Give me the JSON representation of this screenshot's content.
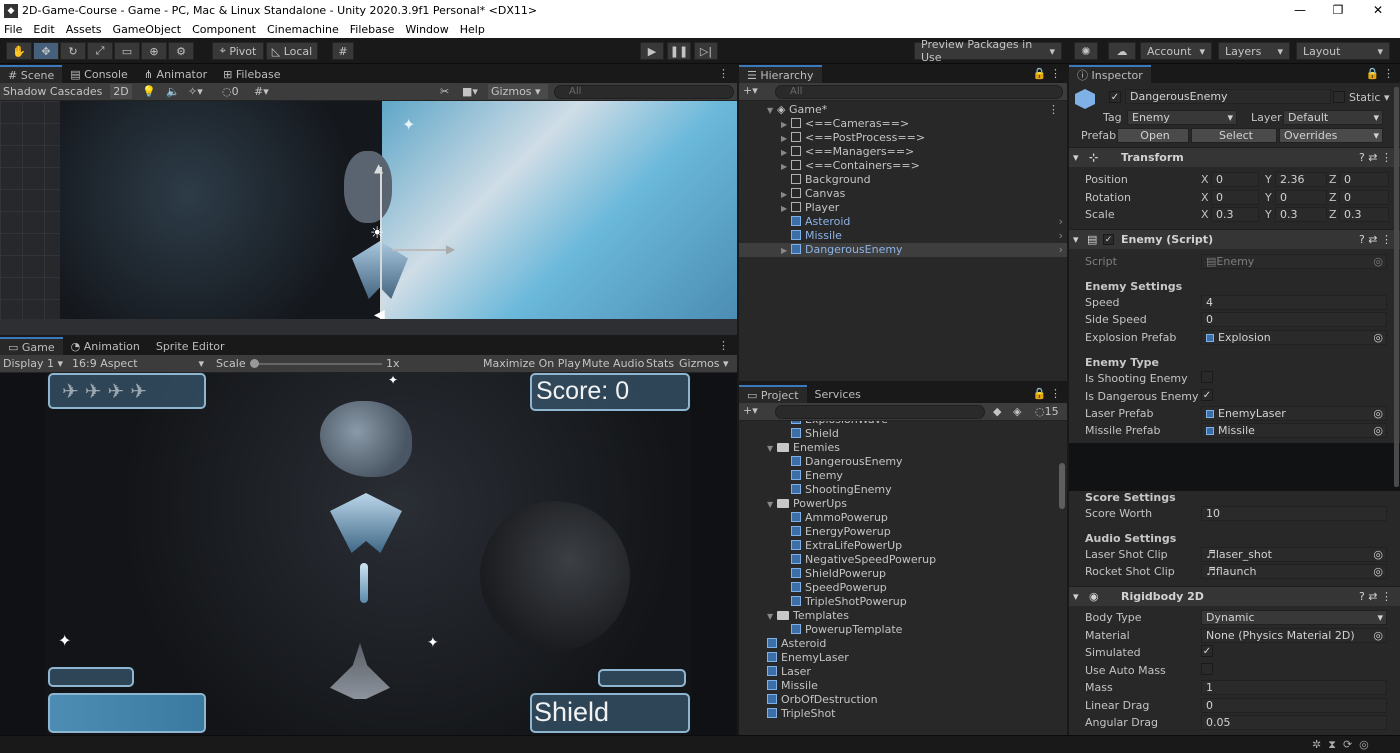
{
  "window": {
    "title": "2D-Game-Course - Game - PC, Mac & Linux Standalone - Unity 2020.3.9f1 Personal* <DX11>"
  },
  "menu": [
    "File",
    "Edit",
    "Assets",
    "GameObject",
    "Component",
    "Cinemachine",
    "Filebase",
    "Window",
    "Help"
  ],
  "toolbar": {
    "pivot": "Pivot",
    "local": "Local",
    "preview_packages": "Preview Packages in Use",
    "account": "Account",
    "layers": "Layers",
    "layout": "Layout"
  },
  "scene": {
    "tabs": [
      "Scene",
      "Console",
      "Animator",
      "Filebase"
    ],
    "shading": "Shadow Cascades",
    "mode_2d": "2D",
    "hidden_count": "0",
    "gizmos": "Gizmos",
    "search_placeholder": "All"
  },
  "game": {
    "tabs": [
      "Game",
      "Animation",
      "Sprite Editor"
    ],
    "display": "Display 1",
    "aspect": "16:9 Aspect",
    "scale_label": "Scale",
    "scale_value": "1x",
    "buttons": [
      "Maximize On Play",
      "Mute Audio",
      "Stats",
      "Gizmos"
    ],
    "score": "Score: 0",
    "shield": "Shield"
  },
  "hierarchy": {
    "title": "Hierarchy",
    "search_placeholder": "All",
    "root": "Game*",
    "items": [
      "<==Cameras==>",
      "<==PostProcess==>",
      "<==Managers==>",
      "<==Containers==>",
      "Background",
      "Canvas",
      "Player",
      "Asteroid",
      "Missile",
      "DangerousEnemy"
    ]
  },
  "project": {
    "tabs": [
      "Project",
      "Services"
    ],
    "hidden_count": "15",
    "items": [
      {
        "name": "ExplosionWave",
        "kind": "file",
        "depth": 2
      },
      {
        "name": "Shield",
        "kind": "file",
        "depth": 2
      },
      {
        "name": "Enemies",
        "kind": "folder",
        "depth": 1
      },
      {
        "name": "DangerousEnemy",
        "kind": "file",
        "depth": 2
      },
      {
        "name": "Enemy",
        "kind": "file",
        "depth": 2
      },
      {
        "name": "ShootingEnemy",
        "kind": "file",
        "depth": 2
      },
      {
        "name": "PowerUps",
        "kind": "folder",
        "depth": 1
      },
      {
        "name": "AmmoPowerup",
        "kind": "file",
        "depth": 2
      },
      {
        "name": "EnergyPowerup",
        "kind": "file",
        "depth": 2
      },
      {
        "name": "ExtraLifePowerUp",
        "kind": "file",
        "depth": 2
      },
      {
        "name": "NegativeSpeedPowerup",
        "kind": "file",
        "depth": 2
      },
      {
        "name": "ShieldPowerup",
        "kind": "file",
        "depth": 2
      },
      {
        "name": "SpeedPowerup",
        "kind": "file",
        "depth": 2
      },
      {
        "name": "TripleShotPowerup",
        "kind": "file",
        "depth": 2
      },
      {
        "name": "Templates",
        "kind": "folder",
        "depth": 1
      },
      {
        "name": "PowerupTemplate",
        "kind": "file",
        "depth": 2
      },
      {
        "name": "Asteroid",
        "kind": "file",
        "depth": 1
      },
      {
        "name": "EnemyLaser",
        "kind": "file",
        "depth": 1
      },
      {
        "name": "Laser",
        "kind": "file",
        "depth": 1
      },
      {
        "name": "Missile",
        "kind": "file",
        "depth": 1
      },
      {
        "name": "OrbOfDestruction",
        "kind": "file",
        "depth": 1
      },
      {
        "name": "TripleShot",
        "kind": "file",
        "depth": 1
      }
    ]
  },
  "inspector": {
    "title": "Inspector",
    "object_name": "DangerousEnemy",
    "static": "Static",
    "tag_label": "Tag",
    "tag": "Enemy",
    "layer_label": "Layer",
    "layer": "Default",
    "prefab_label": "Prefab",
    "open": "Open",
    "select": "Select",
    "overrides": "Overrides",
    "transform": {
      "title": "Transform",
      "position_label": "Position",
      "position": {
        "x": "0",
        "y": "2.36",
        "z": "0"
      },
      "rotation_label": "Rotation",
      "rotation": {
        "x": "0",
        "y": "0",
        "z": "0"
      },
      "scale_label": "Scale",
      "scale": {
        "x": "0.3",
        "y": "0.3",
        "z": "0.3"
      }
    },
    "enemy_script": {
      "title": "Enemy (Script)",
      "script_label": "Script",
      "script": "Enemy",
      "settings_header": "Enemy Settings",
      "speed_label": "Speed",
      "speed": "4",
      "side_speed_label": "Side Speed",
      "side_speed": "0",
      "explosion_label": "Explosion Prefab",
      "explosion": "Explosion",
      "type_header": "Enemy Type",
      "shooting_label": "Is Shooting Enemy",
      "shooting": false,
      "dangerous_label": "Is Dangerous Enemy",
      "dangerous": true,
      "laser_label": "Laser Prefab",
      "laser": "EnemyLaser",
      "missile_label": "Missile Prefab",
      "missile": "Missile",
      "score_header": "Score Settings",
      "score_worth_label": "Score Worth",
      "score_worth": "10",
      "audio_header": "Audio Settings",
      "laser_clip_label": "Laser Shot Clip",
      "laser_clip": "laser_shot",
      "rocket_clip_label": "Rocket Shot Clip",
      "rocket_clip": "flaunch"
    },
    "rigidbody": {
      "title": "Rigidbody 2D",
      "body_type_label": "Body Type",
      "body_type": "Dynamic",
      "material_label": "Material",
      "material": "None (Physics Material 2D)",
      "simulated_label": "Simulated",
      "simulated": true,
      "auto_mass_label": "Use Auto Mass",
      "auto_mass": false,
      "mass_label": "Mass",
      "mass": "1",
      "linear_drag_label": "Linear Drag",
      "linear_drag": "0",
      "angular_drag_label": "Angular Drag",
      "angular_drag": "0.05"
    }
  },
  "colors": {
    "accent": "#3a79bb",
    "selected_row": "#2c5d87",
    "prefab_blue": "#8cb3e6"
  }
}
